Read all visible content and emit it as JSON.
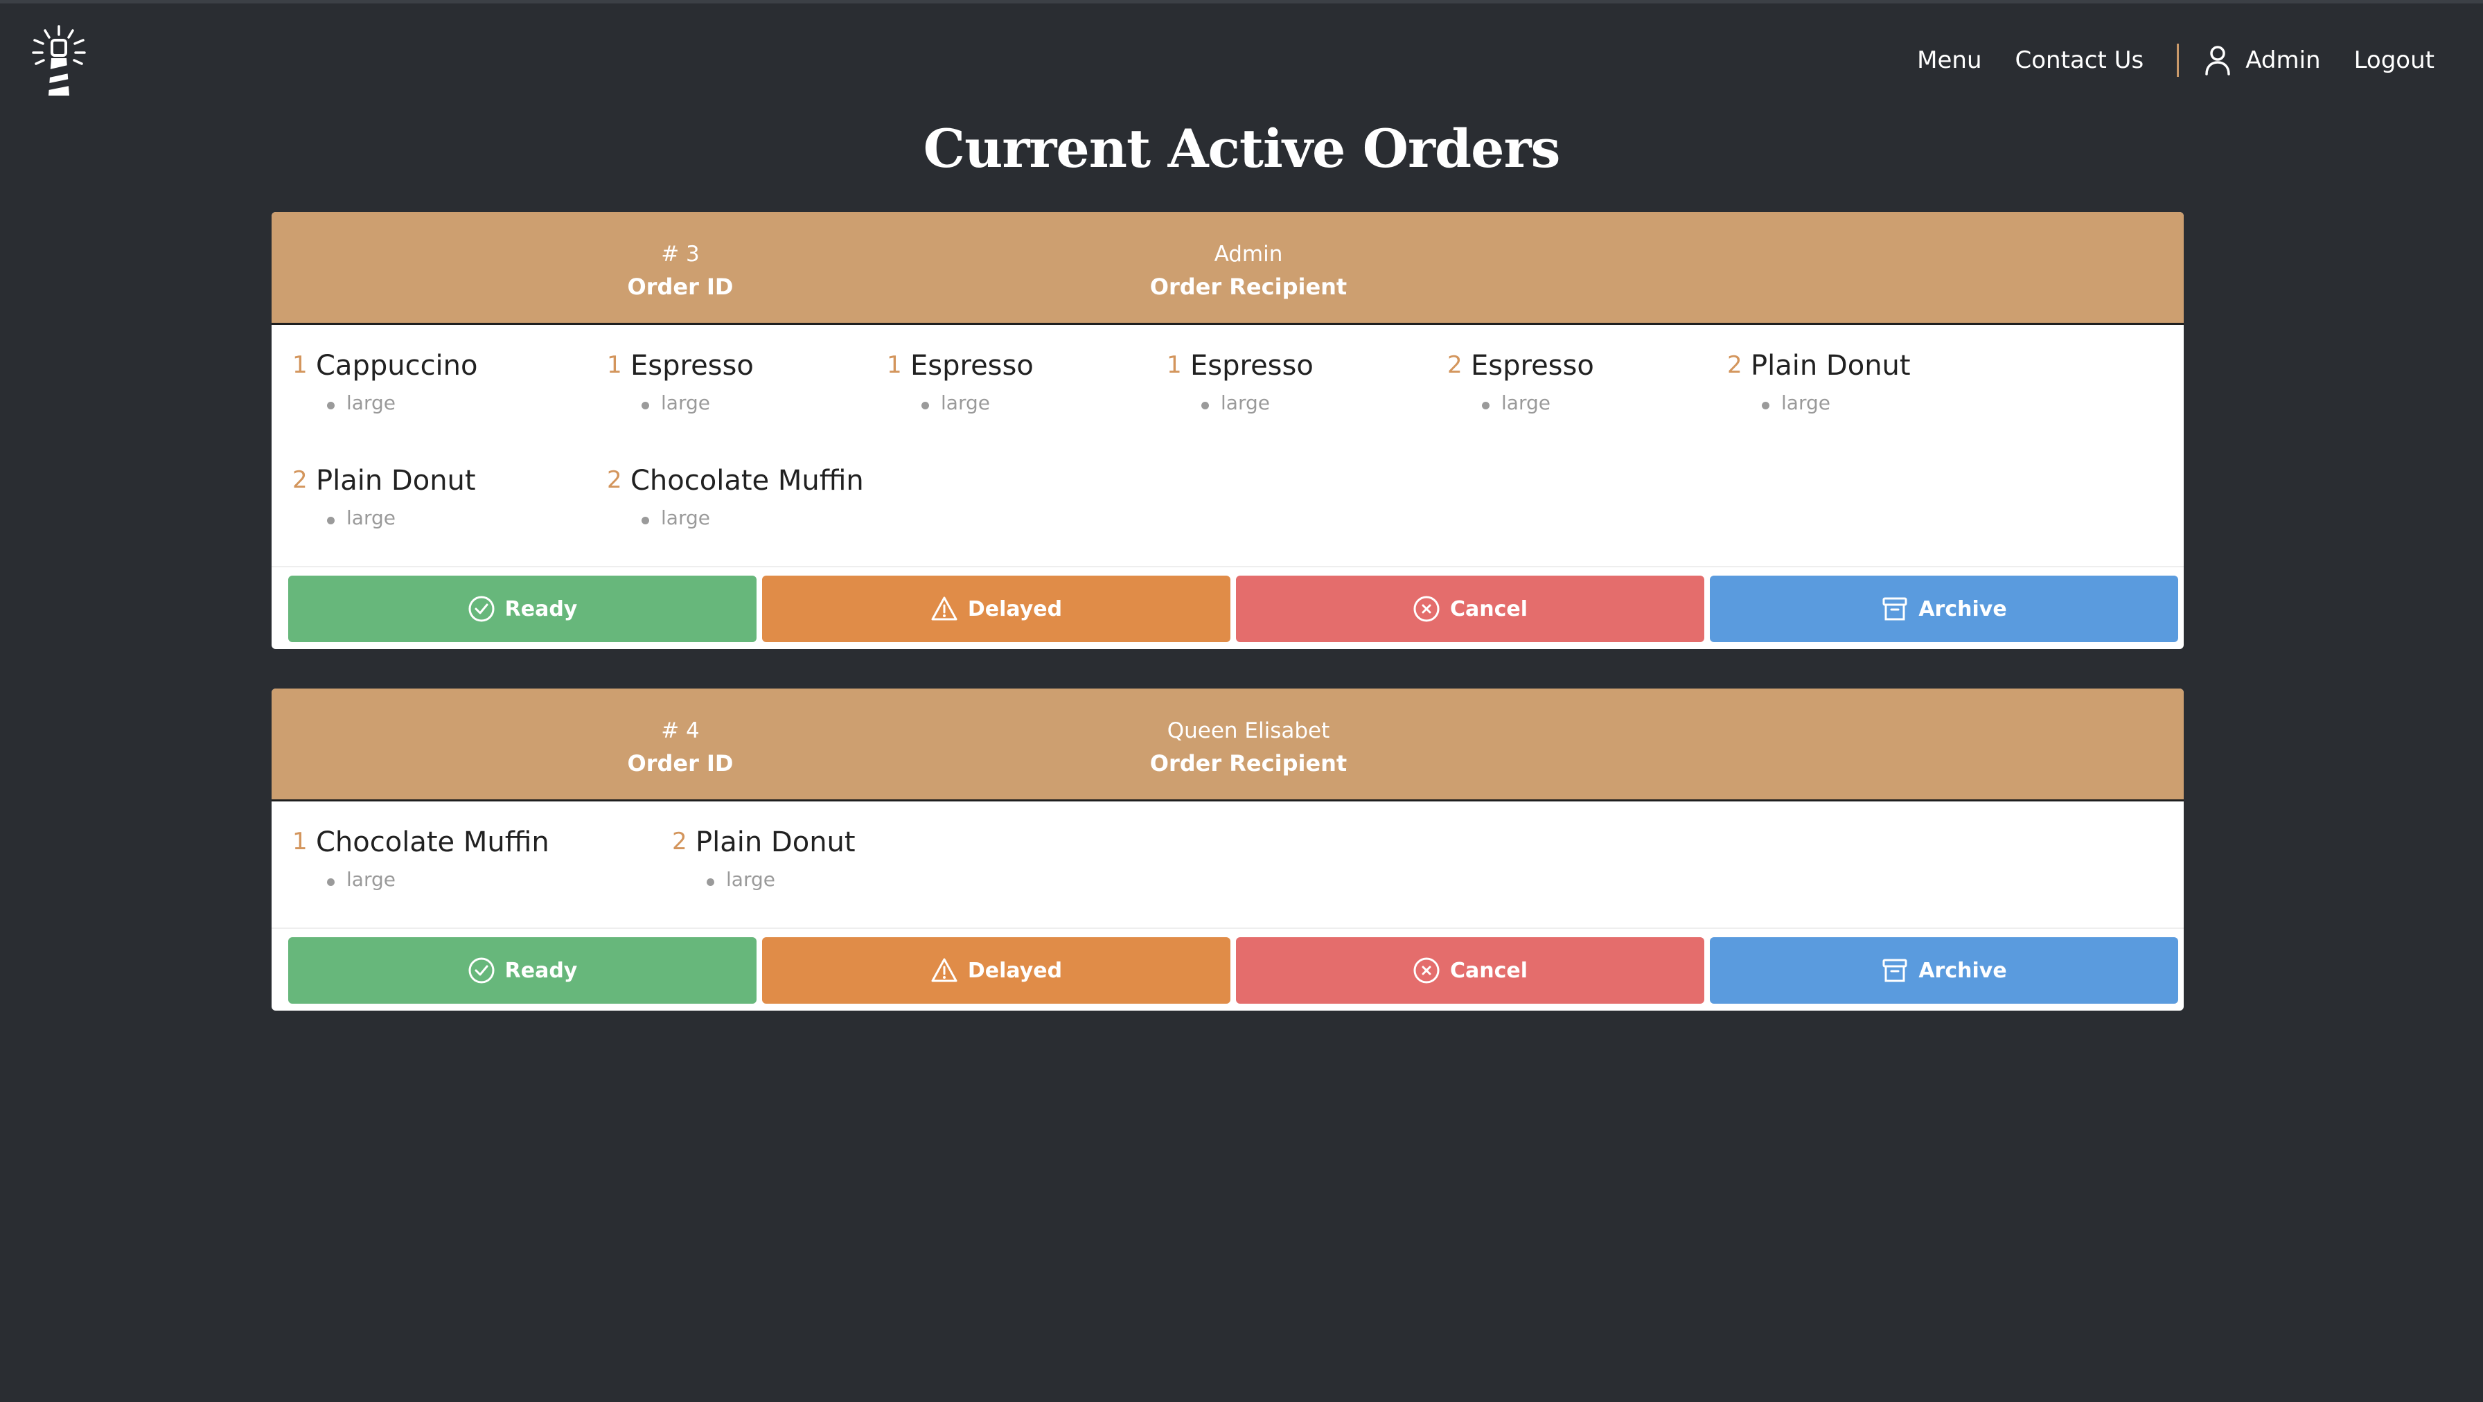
{
  "nav": {
    "menu": "Menu",
    "contact": "Contact Us",
    "user": "Admin",
    "logout": "Logout",
    "logo_icon": "lighthouse-icon",
    "user_icon": "person-icon"
  },
  "page": {
    "title": "Current Active Orders"
  },
  "labels": {
    "order_id": "Order ID",
    "order_recipient": "Order Recipient"
  },
  "buttons": {
    "ready": "Ready",
    "delayed": "Delayed",
    "cancel": "Cancel",
    "archive": "Archive"
  },
  "orders": [
    {
      "id": "# 3",
      "recipient": "Admin",
      "items": [
        {
          "qty": "1",
          "name": "Cappuccino",
          "size": "large"
        },
        {
          "qty": "1",
          "name": "Espresso",
          "size": "large"
        },
        {
          "qty": "1",
          "name": "Espresso",
          "size": "large"
        },
        {
          "qty": "1",
          "name": "Espresso",
          "size": "large"
        },
        {
          "qty": "2",
          "name": "Espresso",
          "size": "large"
        },
        {
          "qty": "2",
          "name": "Plain Donut",
          "size": "large"
        },
        {
          "qty": "2",
          "name": "Plain Donut",
          "size": "large"
        },
        {
          "qty": "2",
          "name": "Chocolate Muffin",
          "size": "large"
        }
      ]
    },
    {
      "id": "# 4",
      "recipient": "Queen Elisabet",
      "items": [
        {
          "qty": "1",
          "name": "Chocolate Muffin",
          "size": "large"
        },
        {
          "qty": "2",
          "name": "Plain Donut",
          "size": "large"
        }
      ]
    }
  ],
  "colors": {
    "background": "#2a2d32",
    "card_header": "#cd9f70",
    "accent": "#d3955c",
    "ready": "#67b77b",
    "delayed": "#e08c48",
    "cancel": "#e46d6c",
    "archive": "#5a9bde"
  }
}
